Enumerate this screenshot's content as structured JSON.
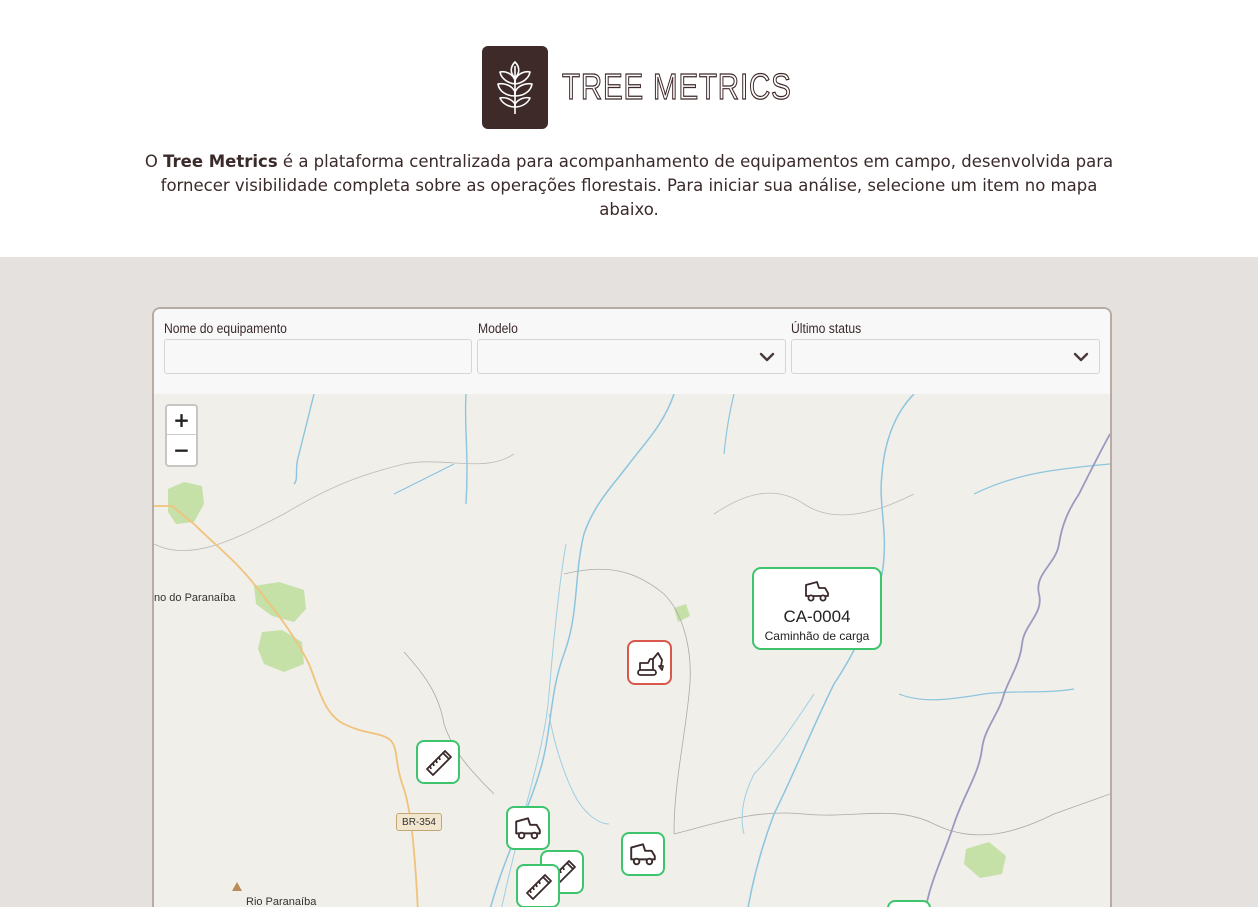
{
  "brand": {
    "name": "TREE METRICS",
    "logo_icon": "leaf-icon",
    "color": "#3f2a2a"
  },
  "intro": {
    "prefix": "O ",
    "brand_bold": "Tree Metrics",
    "text": " é a plataforma centralizada para acompanhamento de equipamentos em campo, desenvolvida para fornecer visibilidade completa sobre as operações florestais. Para iniciar sua análise, selecione um item no mapa abaixo."
  },
  "filters": {
    "name_label": "Nome do equipamento",
    "name_value": "",
    "model_label": "Modelo",
    "model_value": "",
    "status_label": "Último status",
    "status_value": ""
  },
  "map": {
    "zoom_in": "+",
    "zoom_out": "−",
    "place_labels": [
      "no do Paranaíba",
      "Rio Paranaíba"
    ],
    "road_badge": "BR-354",
    "popup": {
      "code": "CA-0004",
      "type": "Caminhão de carga",
      "icon": "truck-icon"
    },
    "status_colors": {
      "operating": "#3fc46e",
      "stopped": "#d9574b"
    },
    "markers": [
      {
        "icon": "saw-icon",
        "status": "operating"
      },
      {
        "icon": "excavator-icon",
        "status": "stopped"
      },
      {
        "icon": "truck-icon",
        "status": "operating"
      },
      {
        "icon": "truck-icon",
        "status": "operating"
      },
      {
        "icon": "saw-icon",
        "status": "operating"
      },
      {
        "icon": "saw-icon",
        "status": "operating"
      }
    ]
  }
}
